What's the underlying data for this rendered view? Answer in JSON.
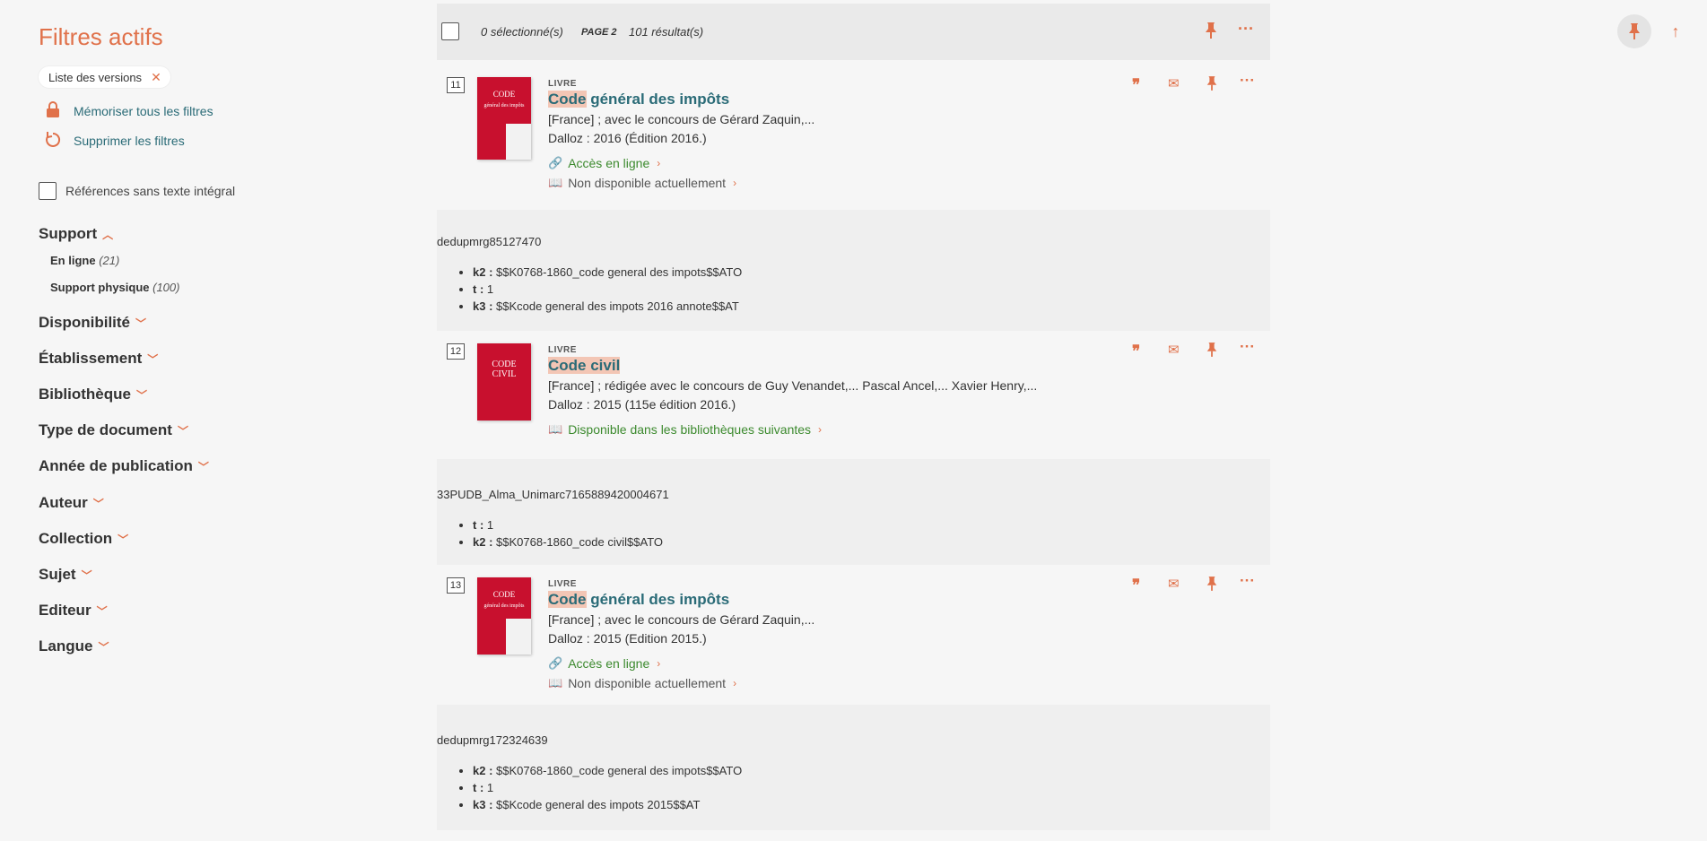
{
  "sidebar": {
    "title": "Filtres actifs",
    "chip": "Liste des versions",
    "memorize": "Mémoriser tous les filtres",
    "remove": "Supprimer les filtres",
    "refs_label": "Références sans texte intégral",
    "support": "Support",
    "support_items": [
      {
        "label": "En ligne",
        "count": "(21)"
      },
      {
        "label": "Support physique",
        "count": "(100)"
      }
    ],
    "facets": [
      "Disponibilité",
      "Établissement",
      "Bibliothèque",
      "Type de document",
      "Année de publication",
      "Auteur",
      "Collection",
      "Sujet",
      "Editeur",
      "Langue"
    ]
  },
  "toolbar": {
    "selected": "0 sélectionné(s)",
    "page": "PAGE 2",
    "results": "101 résultat(s)"
  },
  "records": [
    {
      "num": "11",
      "type": "LIVRE",
      "title_hl": "Code",
      "title_rest": " général des impôts",
      "line1": "[France] ; avec le concours de Gérard Zaquin,...",
      "line2": "Dalloz : 2016 (Édition 2016.)",
      "link1": "Accès en ligne",
      "link2": "Non disponible actuellement",
      "cover_text": "CODE\ngénéral des impôts",
      "dedup_id": "dedupmrg85127470",
      "dedup_items": [
        {
          "k": "k2 :",
          "v": "$$K0768-1860_code general des impots$$ATO"
        },
        {
          "k": "t :",
          "v": "1"
        },
        {
          "k": "k3 :",
          "v": "$$Kcode general des impots 2016 annote$$AT"
        }
      ]
    },
    {
      "num": "12",
      "type": "LIVRE",
      "title_hl": "Code civil",
      "title_rest": "",
      "line1": "[France] ; rédigée avec le concours de Guy Venandet,... Pascal Ancel,... Xavier Henry,...",
      "line2": "Dalloz : 2015 (115e édition 2016.)",
      "link1": "Disponible dans les bibliothèques suivantes",
      "cover_text": "CODE\nCIVIL",
      "dedup_id": "33PUDB_Alma_Unimarc7165889420004671",
      "dedup_items": [
        {
          "k": "t :",
          "v": "1"
        },
        {
          "k": "k2 :",
          "v": "$$K0768-1860_code civil$$ATO"
        }
      ]
    },
    {
      "num": "13",
      "type": "LIVRE",
      "title_hl": "Code",
      "title_rest": " général des impôts",
      "line1": "[France] ; avec le concours de Gérard Zaquin,...",
      "line2": "Dalloz : 2015 (Edition 2015.)",
      "link1": "Accès en ligne",
      "link2": "Non disponible actuellement",
      "cover_text": "CODE\ngénéral des impôts",
      "dedup_id": "dedupmrg172324639",
      "dedup_items": [
        {
          "k": "k2 :",
          "v": "$$K0768-1860_code general des impots$$ATO"
        },
        {
          "k": "t :",
          "v": "1"
        },
        {
          "k": "k3 :",
          "v": "$$Kcode general des impots 2015$$AT"
        }
      ]
    }
  ]
}
